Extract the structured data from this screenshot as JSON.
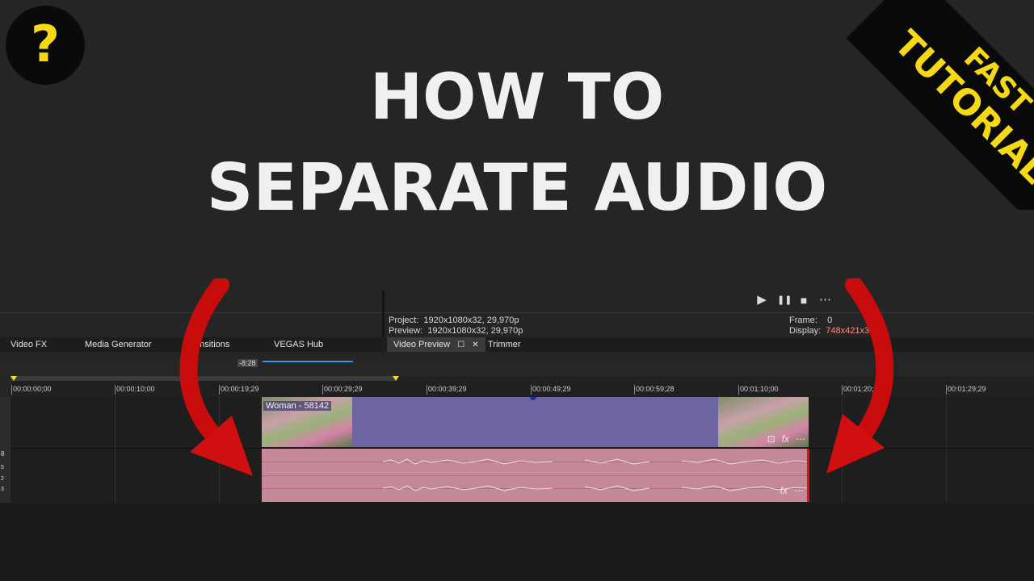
{
  "thumbnail": {
    "help_symbol": "?",
    "title_line1": "HOW TO",
    "title_line2": "SEPARATE AUDIO",
    "ribbon_line1": "FAST",
    "ribbon_line2": "TUTORIAL",
    "accent_color": "#f5d917",
    "arrow_color": "#d01010"
  },
  "transport": {
    "play_icon": "▶",
    "pause_icon": "❚❚",
    "stop_icon": "■",
    "more_icon": "⋯"
  },
  "preview_info": {
    "project_label": "Project:",
    "project_value": "1920x1080x32, 29,970p",
    "preview_label": "Preview:",
    "preview_value": "1920x1080x32, 29,970p",
    "frame_label": "Frame:",
    "frame_value": "0",
    "display_label": "Display:",
    "display_value": "748x421x32"
  },
  "tabs": [
    "Video FX",
    "Media Generator",
    "Transitions",
    "VEGAS Hub",
    "Video Preview",
    "Trimmer"
  ],
  "timeline": {
    "cursor_offset": "-8:28",
    "ruler_labels": [
      "00:00:00;00",
      "00:00:10;00",
      "00:00:19;29",
      "00:00:29;29",
      "00:00:39;29",
      "00:00:49;29",
      "00:00:59;28",
      "00:01:10;00",
      "00:01:20;00",
      "00:01:29;29"
    ],
    "track_header_digits": [
      "8",
      "5",
      "2",
      "3"
    ],
    "video_clip_name": "Woman - 58142",
    "clip_icons": [
      "crop-icon",
      "fx",
      "⋯"
    ],
    "audio_fx": "fx",
    "audio_more": "⋯"
  }
}
